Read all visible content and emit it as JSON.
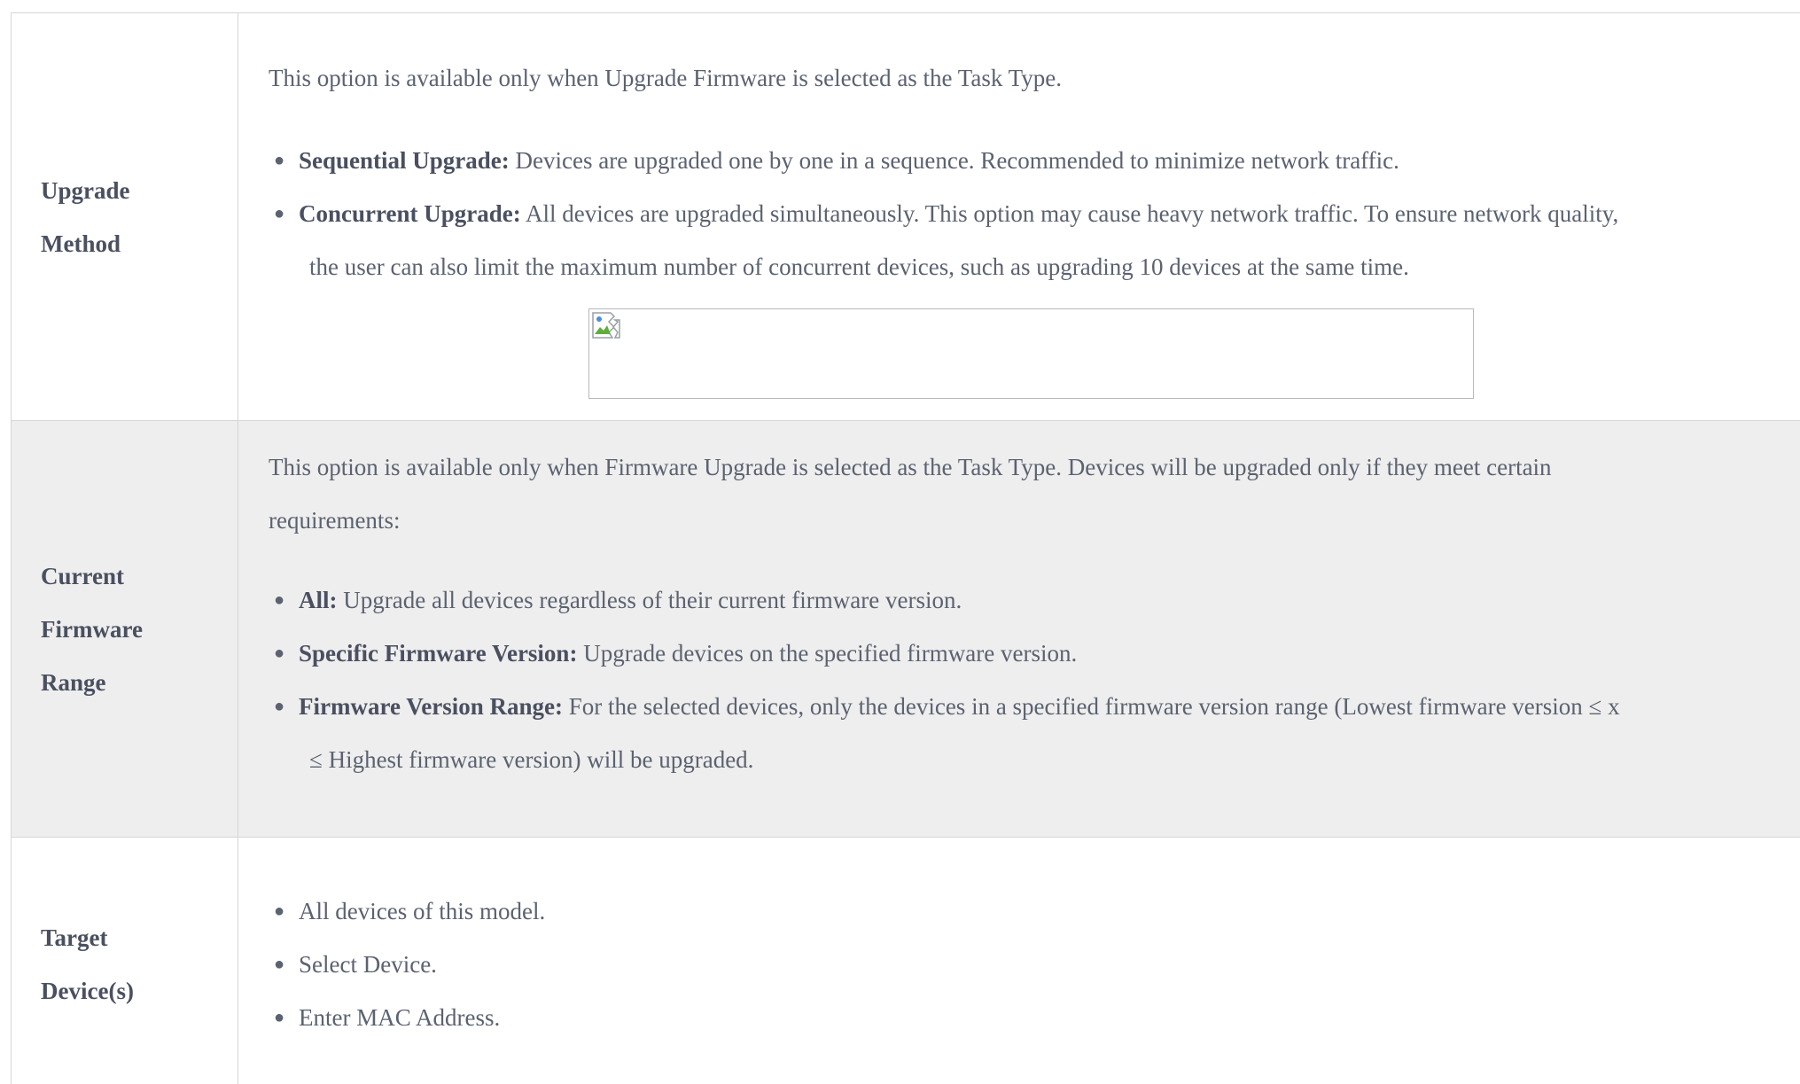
{
  "rows": [
    {
      "label": [
        "Upgrade",
        "Method"
      ],
      "intro": "This option is available only when Upgrade Firmware is selected as the Task Type.",
      "bullets": [
        {
          "term": "Sequential Upgrade:",
          "text": " Devices are upgraded one by one in a sequence. Recommended to minimize network traffic.",
          "cont": ""
        },
        {
          "term": "Concurrent Upgrade:",
          "text": " All devices are upgraded simultaneously. This option may cause heavy network traffic. To ensure network quality,",
          "cont": "the user can also limit the maximum number of concurrent devices, such as upgrading 10 devices at the same time."
        }
      ],
      "has_image": true
    },
    {
      "label": [
        "Current",
        "Firmware",
        "Range"
      ],
      "intro_lines": [
        "This option is available only when Firmware Upgrade is selected as the Task Type. Devices will be upgraded only if they meet certain",
        "requirements:"
      ],
      "bullets": [
        {
          "term": "All:",
          "text": " Upgrade all devices regardless of their current firmware version.",
          "cont": ""
        },
        {
          "term": "Specific Firmware Version:",
          "text": " Upgrade devices on the specified firmware version.",
          "cont": ""
        },
        {
          "term": "Firmware Version Range:",
          "text": " For the selected devices, only the devices in a specified firmware version range (Lowest firmware version ≤ x",
          "cont": "≤ Highest firmware version) will be upgraded."
        }
      ]
    },
    {
      "label": [
        "Target",
        "Device(s)"
      ],
      "bullets": [
        {
          "text": "All devices of this model."
        },
        {
          "text": "Select Device."
        },
        {
          "text": "Enter MAC Address."
        }
      ]
    }
  ],
  "bullet_glyph": "●",
  "colors": {
    "text": "#5b6270",
    "label": "#4a5060",
    "border": "#d6d6d6",
    "shaded_row": "#eeeeee"
  },
  "icons": {
    "broken_image": "broken-image-icon"
  }
}
